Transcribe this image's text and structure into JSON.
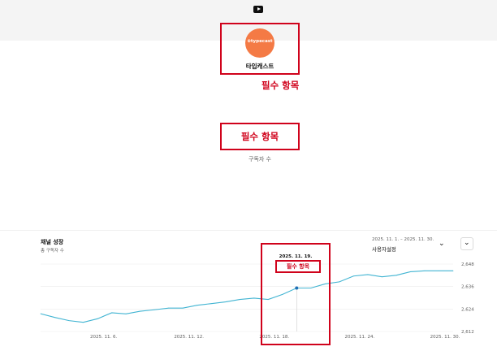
{
  "header": {
    "logo_icon": "youtube-icon"
  },
  "channel": {
    "avatar_text": "⊛typecast",
    "name": "타입캐스트",
    "avatar_color": "#f47a45"
  },
  "annotations": {
    "required_1": "필수 항목",
    "required_2": "필수 항목",
    "required_3": "필수 항목",
    "annotation_color": "#d0021b"
  },
  "subscribers": {
    "label": "구독자 수"
  },
  "chart_panel": {
    "title": "채널 성장",
    "subtitle": "총 구독자 수",
    "date_range": "2025. 11. 1. – 2025. 11. 30.",
    "period_label": "사용자설정",
    "tooltip_date": "2025. 11. 19."
  },
  "chart_data": {
    "type": "line",
    "title": "채널 성장",
    "xlabel": "",
    "ylabel": "",
    "x_tick_labels": [
      "2025. 11. 6.",
      "2025. 11. 12.",
      "2025. 11. 18.",
      "2025. 11. 24.",
      "2025. 11. 30."
    ],
    "x_ticks": [
      6,
      12,
      18,
      24,
      30
    ],
    "y_tick_labels": [
      "2,612",
      "2,624",
      "2,636",
      "2,648"
    ],
    "y_ticks": [
      2612,
      2624,
      2636,
      2648
    ],
    "xlim": [
      1,
      30
    ],
    "ylim": [
      2612,
      2648
    ],
    "grid": true,
    "line_color": "#41b4d2",
    "highlight_x": 19,
    "series": [
      {
        "x": [
          1,
          2,
          3,
          4,
          5,
          6,
          7,
          8,
          9,
          10,
          11,
          12,
          13,
          14,
          15,
          16,
          17,
          18,
          19,
          20,
          21,
          22,
          23,
          24,
          25,
          26,
          27,
          28,
          29,
          30
        ],
        "values": [
          2621.5,
          2619.5,
          2617.8,
          2616.9,
          2618.8,
          2622,
          2621.4,
          2622.8,
          2623.6,
          2624.5,
          2624.5,
          2626,
          2626.9,
          2627.8,
          2629.1,
          2629.8,
          2629.1,
          2631.8,
          2635.2,
          2635.2,
          2637.4,
          2638.5,
          2641.6,
          2642.4,
          2641.2,
          2642,
          2643.9,
          2644.4,
          2644.4,
          2644.4
        ]
      }
    ]
  }
}
